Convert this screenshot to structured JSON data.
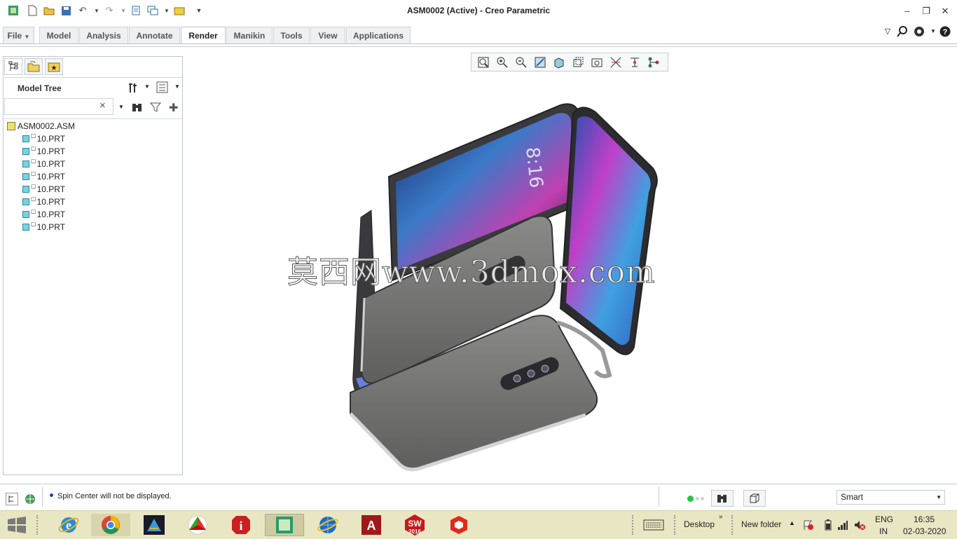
{
  "window": {
    "title": "ASM0002 (Active) - Creo Parametric",
    "quick_access_icons": [
      "app-icon",
      "new-icon",
      "open-icon",
      "save-icon",
      "undo-icon",
      "undo-dropdown-icon",
      "redo-icon",
      "redo-dropdown-icon",
      "regenerate-icon",
      "windows-icon",
      "windows-dropdown-icon",
      "close-window-icon",
      "customize-dropdown-icon"
    ],
    "controls": [
      "minimize-icon",
      "restore-icon",
      "close-icon"
    ]
  },
  "ribbon": {
    "tabs": [
      {
        "label": "File",
        "active": false
      },
      {
        "label": "Model",
        "active": false
      },
      {
        "label": "Analysis",
        "active": false
      },
      {
        "label": "Annotate",
        "active": false
      },
      {
        "label": "Render",
        "active": true
      },
      {
        "label": "Manikin",
        "active": false
      },
      {
        "label": "Tools",
        "active": false
      },
      {
        "label": "View",
        "active": false
      },
      {
        "label": "Applications",
        "active": false
      }
    ],
    "right_icons": [
      "minimize-ribbon-icon",
      "search-icon",
      "community-icon",
      "help-icon"
    ]
  },
  "navigator": {
    "tabs": [
      "model-tree-tab-icon",
      "folder-browser-tab-icon",
      "favorites-tab-icon"
    ],
    "model_tree_title": "Model Tree",
    "search_value": "",
    "clear_symbol": "×",
    "tree": {
      "root": "ASM0002.ASM",
      "children": [
        "10.PRT",
        "10.PRT",
        "10.PRT",
        "10.PRT",
        "10.PRT",
        "10.PRT",
        "10.PRT",
        "10.PRT"
      ]
    }
  },
  "graphics_toolbar": {
    "icons": [
      "refit-icon",
      "zoom-in-icon",
      "zoom-out-icon",
      "repaint-icon",
      "display-style-icon",
      "saved-orientations-icon",
      "perspective-icon",
      "datum-display-icon",
      "spin-center-icon",
      "annotation-display-icon"
    ]
  },
  "viewport": {
    "watermark": "莫西网www.3dmox.com",
    "phone_screen_time": "8:16"
  },
  "status_bar": {
    "message": "Spin Center will not be displayed.",
    "filter_value": "Smart"
  },
  "taskbar": {
    "apps": [
      {
        "name": "internet-explorer",
        "label": "e"
      },
      {
        "name": "chrome",
        "label": ""
      },
      {
        "name": "3ds-max",
        "label": ""
      },
      {
        "name": "app-red-green",
        "label": ""
      },
      {
        "name": "info-app",
        "label": "i"
      },
      {
        "name": "creo",
        "label": ""
      },
      {
        "name": "globe-app",
        "label": ""
      },
      {
        "name": "autocad",
        "label": "A"
      },
      {
        "name": "solidworks-2016",
        "label": "SW",
        "sub": "2016"
      },
      {
        "name": "sketchup",
        "label": ""
      }
    ],
    "desktop_label": "Desktop",
    "new_folder_label": "New folder",
    "language": "ENG",
    "region": "IN",
    "time": "16:35",
    "date": "02-03-2020"
  }
}
